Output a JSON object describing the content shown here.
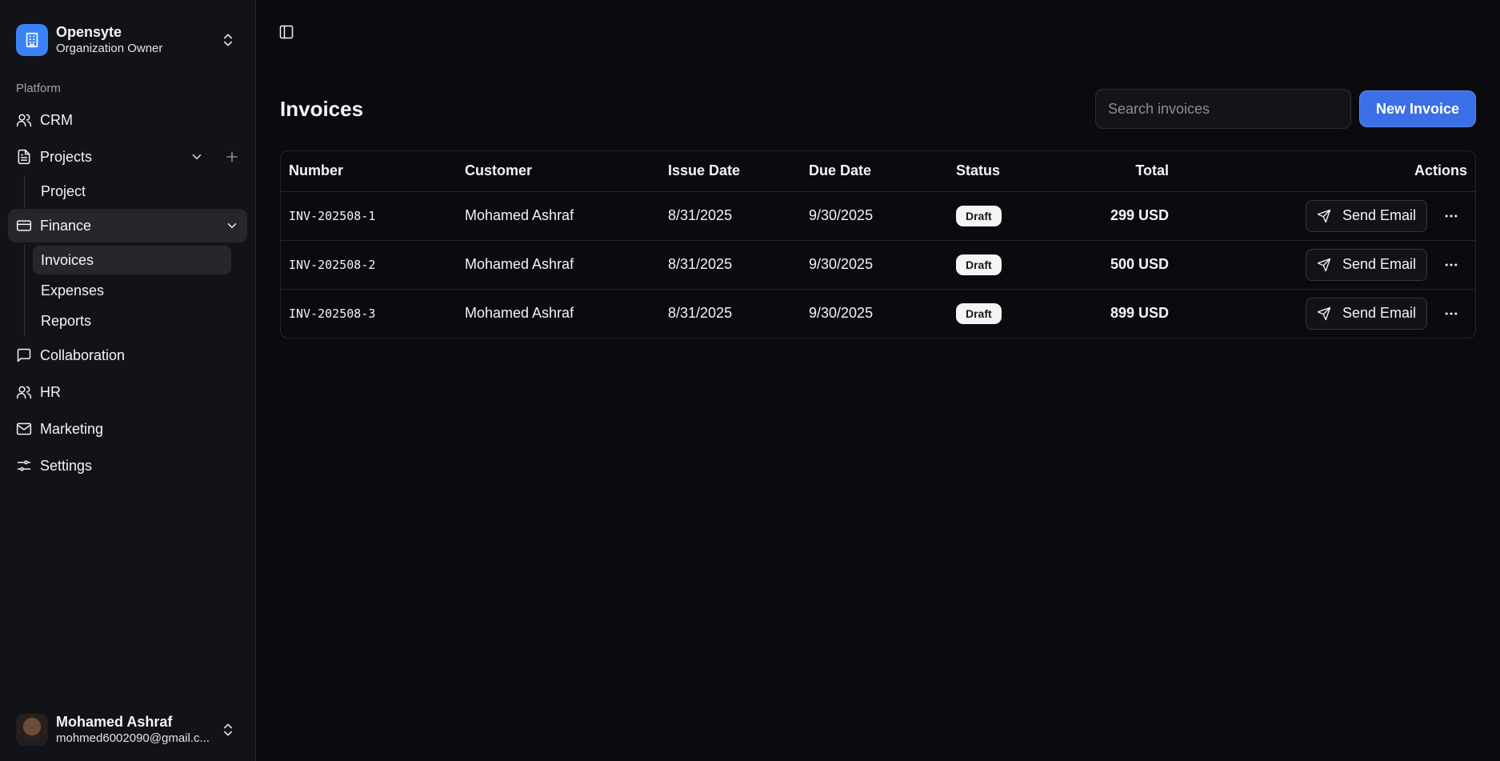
{
  "org": {
    "name": "Opensyte",
    "role": "Organization Owner"
  },
  "sidebar": {
    "group_label": "Platform",
    "crm": "CRM",
    "projects": "Projects",
    "projects_sub": [
      "Project"
    ],
    "finance": "Finance",
    "finance_sub": [
      "Invoices",
      "Expenses",
      "Reports"
    ],
    "collaboration": "Collaboration",
    "hr": "HR",
    "marketing": "Marketing",
    "settings": "Settings"
  },
  "user": {
    "name": "Mohamed Ashraf",
    "email": "mohmed6002090@gmail.c..."
  },
  "page": {
    "title": "Invoices",
    "search_placeholder": "Search invoices",
    "new_button": "New Invoice"
  },
  "table": {
    "headers": [
      "Number",
      "Customer",
      "Issue Date",
      "Due Date",
      "Status",
      "Total",
      "Actions"
    ],
    "rows": [
      {
        "number": "INV-202508-1",
        "customer": "Mohamed Ashraf",
        "issue": "8/31/2025",
        "due": "9/30/2025",
        "status": "Draft",
        "total": "299 USD"
      },
      {
        "number": "INV-202508-2",
        "customer": "Mohamed Ashraf",
        "issue": "8/31/2025",
        "due": "9/30/2025",
        "status": "Draft",
        "total": "500 USD"
      },
      {
        "number": "INV-202508-3",
        "customer": "Mohamed Ashraf",
        "issue": "8/31/2025",
        "due": "9/30/2025",
        "status": "Draft",
        "total": "899 USD"
      }
    ],
    "send_label": "Send Email"
  },
  "colors": {
    "accent": "#3b82f6",
    "background": "#0a0b0f",
    "sidebar": "#111318"
  }
}
